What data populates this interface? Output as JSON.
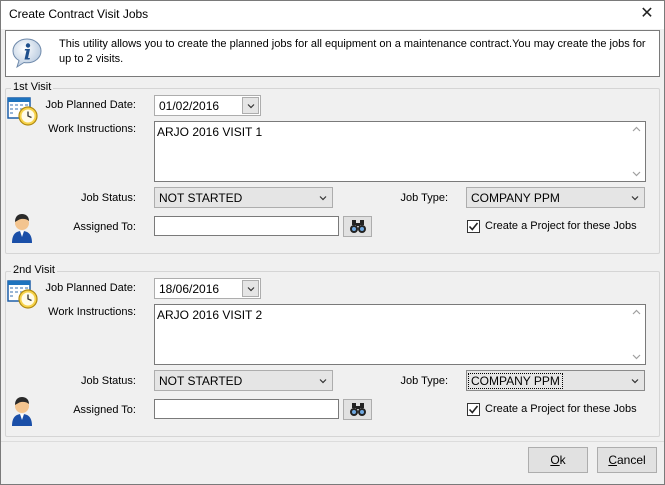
{
  "window": {
    "title": "Create Contract Visit Jobs",
    "close_glyph": "✕"
  },
  "info": {
    "text": "This utility allows you to create the planned jobs for all equipment on a maintenance contract.You may create the jobs for up to 2 visits."
  },
  "visits": [
    {
      "caption": "1st Visit",
      "planned_date_label": "Job Planned Date:",
      "planned_date": "01/02/2016",
      "instructions_label": "Work Instructions:",
      "instructions": "ARJO 2016 VISIT 1",
      "status_label": "Job Status:",
      "status": "NOT STARTED",
      "type_label": "Job Type:",
      "type": "COMPANY PPM",
      "assigned_label": "Assigned To:",
      "assigned_value": "",
      "project_label": "Create a Project for these Jobs",
      "project_checked": true
    },
    {
      "caption": "2nd Visit",
      "planned_date_label": "Job Planned Date:",
      "planned_date": "18/06/2016",
      "instructions_label": "Work Instructions:",
      "instructions": "ARJO 2016 VISIT 2",
      "status_label": "Job Status:",
      "status": "NOT STARTED",
      "type_label": "Job Type:",
      "type": "COMPANY PPM",
      "assigned_label": "Assigned To:",
      "assigned_value": "",
      "project_label": "Create a Project for these Jobs",
      "project_checked": true
    }
  ],
  "buttons": {
    "ok_accel": "O",
    "ok_rest": "k",
    "cancel_accel": "C",
    "cancel_rest": "ancel"
  },
  "icons": {
    "info": "info-icon",
    "calendar": "calendar-clock-icon",
    "user": "user-icon",
    "find": "binoculars-icon",
    "dropdown": "chevron-down-icon",
    "check": "check-icon"
  },
  "colors": {
    "accent": "#1e73be",
    "user_shirt": "#1a4fa8"
  }
}
